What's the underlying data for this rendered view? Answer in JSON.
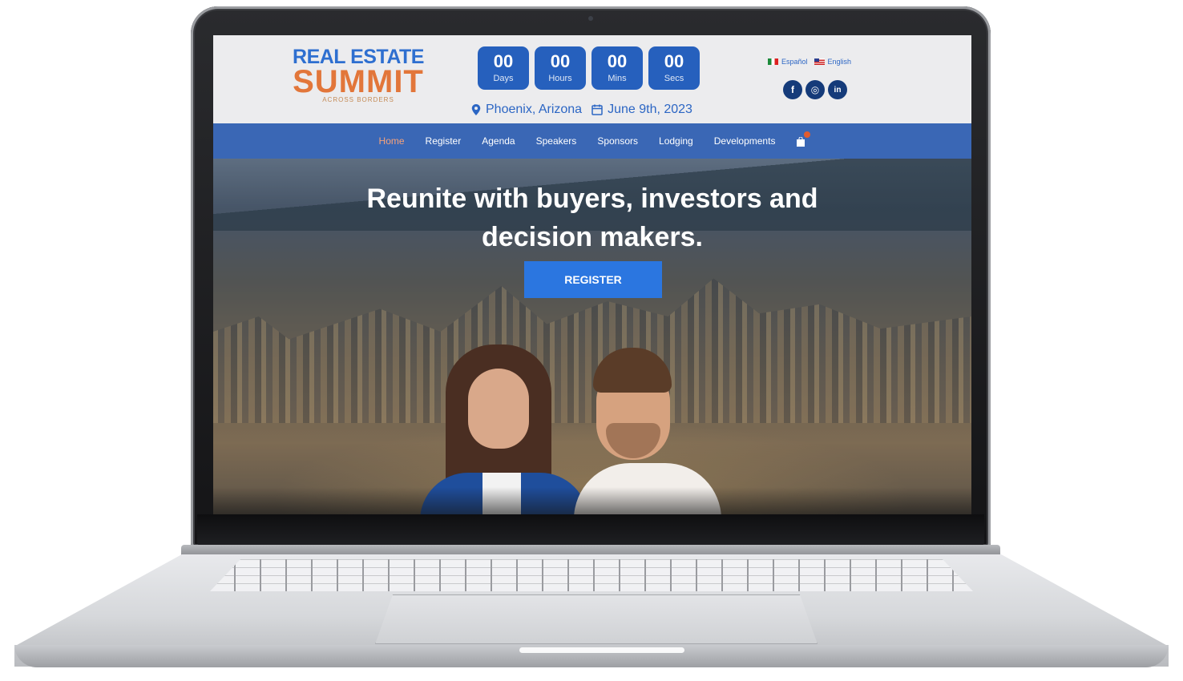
{
  "logo": {
    "line1": "REAL ESTATE",
    "line2": "SUMMIT",
    "tagline": "ACROSS BORDERS"
  },
  "countdown": [
    {
      "value": "00",
      "label": "Days"
    },
    {
      "value": "00",
      "label": "Hours"
    },
    {
      "value": "00",
      "label": "Mins"
    },
    {
      "value": "00",
      "label": "Secs"
    }
  ],
  "event": {
    "location": "Phoenix, Arizona",
    "date": "June 9th, 2023"
  },
  "languages": [
    {
      "label": "Español",
      "flag": "mx-flag-icon"
    },
    {
      "label": "English",
      "flag": "us-flag-icon"
    }
  ],
  "social": [
    {
      "name": "facebook-icon",
      "glyph": "f"
    },
    {
      "name": "instagram-icon",
      "glyph": "◎"
    },
    {
      "name": "linkedin-icon",
      "glyph": "in"
    }
  ],
  "nav": [
    {
      "label": "Home",
      "active": true
    },
    {
      "label": "Register",
      "active": false
    },
    {
      "label": "Agenda",
      "active": false
    },
    {
      "label": "Speakers",
      "active": false
    },
    {
      "label": "Sponsors",
      "active": false
    },
    {
      "label": "Lodging",
      "active": false
    },
    {
      "label": "Developments",
      "active": false
    }
  ],
  "hero": {
    "headline": "Reunite with buyers, investors and decision makers.",
    "cta": "REGISTER"
  },
  "colors": {
    "brand_blue": "#2660bd",
    "nav_blue": "#3a67b5",
    "accent_orange": "#e2763a",
    "cta_blue": "#2b76e0"
  }
}
